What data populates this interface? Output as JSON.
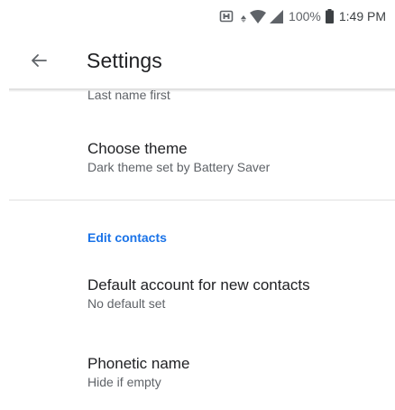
{
  "status_bar": {
    "icons": [
      "nfc-icon",
      "data-arrows-icon",
      "wifi-icon",
      "cell-signal-icon",
      "battery-icon"
    ],
    "battery_percent": "100%",
    "time": "1:49 PM"
  },
  "toolbar": {
    "back_icon": "arrow-back-icon",
    "title": "Settings"
  },
  "settings": {
    "cut_off_value": "Last name first",
    "choose_theme": {
      "title": "Choose theme",
      "summary": "Dark theme set by Battery Saver"
    },
    "section_header": "Edit contacts",
    "default_account": {
      "title": "Default account for new contacts",
      "summary": "No default set"
    },
    "phonetic_name": {
      "title": "Phonetic name",
      "summary": "Hide if empty"
    }
  },
  "colors": {
    "accent": "#1a73e8",
    "primary_text": "#202124",
    "secondary_text": "#5f6368",
    "divider": "#e0e0e0"
  }
}
